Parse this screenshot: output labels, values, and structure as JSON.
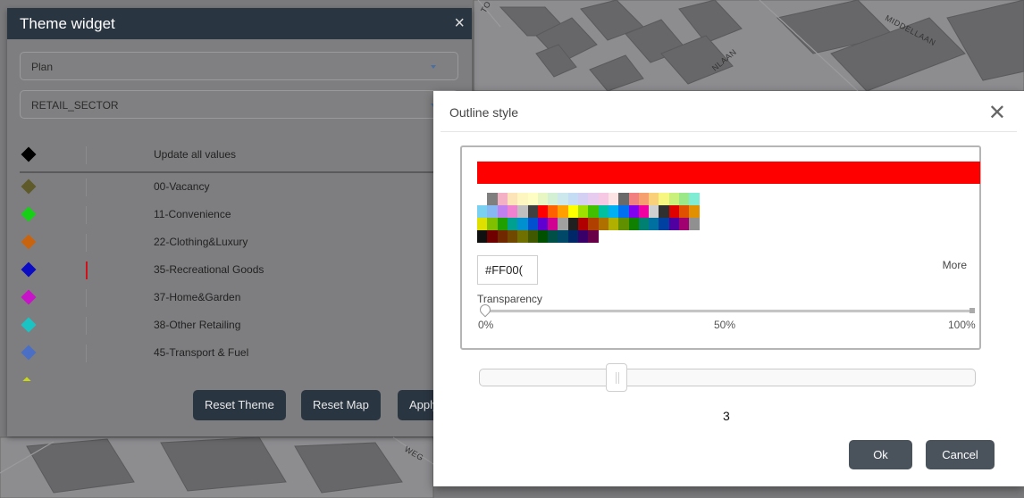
{
  "map": {
    "street_labels": [
      "MIDDELLAAN",
      "NLAAN",
      "WEG",
      "TO"
    ]
  },
  "theme_widget": {
    "title": "Theme widget",
    "close_symbol": "×",
    "plan_select": {
      "value": "Plan"
    },
    "field_select": {
      "value": "RETAIL_SECTOR"
    },
    "update_all": {
      "label": "Update all values",
      "color": "#000000"
    },
    "categories": [
      {
        "label": "00-Vacancy",
        "color": "#5f5a2a"
      },
      {
        "label": "11-Convenience",
        "color": "#16d016"
      },
      {
        "label": "22-Clothing&Luxury",
        "color": "#c8640f"
      },
      {
        "label": "35-Recreational Goods",
        "color": "#0b0bc4",
        "outline_color": "#d0101a"
      },
      {
        "label": "37-Home&Garden",
        "color": "#c814c8"
      },
      {
        "label": "38-Other Retailing",
        "color": "#1ac4c4"
      },
      {
        "label": "45-Transport & Fuel",
        "color": "#4a6fc4"
      }
    ],
    "buttons": {
      "reset_theme": "Reset Theme",
      "reset_map": "Reset Map",
      "apply": "Apply"
    }
  },
  "outline_dialog": {
    "title": "Outline style",
    "close_symbol": "✕",
    "selected_color": "#FF0000",
    "hex_value": "#FF00(",
    "more_label": "More",
    "transparency_label": "Transparency",
    "transparency_value": 0,
    "ticks": [
      "0%",
      "50%",
      "100%"
    ],
    "width_value": "3",
    "ok_label": "Ok",
    "cancel_label": "Cancel",
    "palette": [
      [
        "#ffffff",
        "#7f7f7f",
        "#f4b0c4",
        "#fde4b8",
        "#fef6c0",
        "#fefec4",
        "#e8f6c4",
        "#d4f0d4",
        "#cce8ec",
        "#c4dcf4",
        "#d4d0f4",
        "#e8ccf0",
        "#f6c8e4",
        "#fce4e4",
        "#6a6a6a",
        "#f28080",
        "#f6a070",
        "#fbd07a",
        "#f6f680",
        "#c8f07a",
        "#9ae888",
        "#80ecd4"
      ],
      [
        "#7ad0f0",
        "#88b8f4",
        "#c080f0",
        "#f080d0",
        "#bfbfbf",
        "#404040",
        "#ff0000",
        "#ff6000",
        "#ffa000",
        "#ffff00",
        "#a0e000",
        "#40c000",
        "#00c0a0",
        "#00b0f0",
        "#0070f0",
        "#8000f0",
        "#f000a0",
        "#d0d0d0",
        "#303030",
        "#e00000",
        "#e05000",
        "#e09000"
      ],
      [
        "#e0e000",
        "#80c000",
        "#20a000",
        "#00a090",
        "#0090d0",
        "#0050d0",
        "#6000d0",
        "#d00090",
        "#a0a0a0",
        "#202020",
        "#b00000",
        "#b04000",
        "#b07000",
        "#b0b000",
        "#609000",
        "#108000",
        "#008070",
        "#0070a0",
        "#0040a0",
        "#5000a0",
        "#a00070",
        "#909090"
      ],
      [
        "#101010",
        "#700000",
        "#702800",
        "#704800",
        "#707000",
        "#405800",
        "#005000",
        "#005048",
        "#004868",
        "#002868",
        "#380068",
        "#680048"
      ]
    ]
  }
}
